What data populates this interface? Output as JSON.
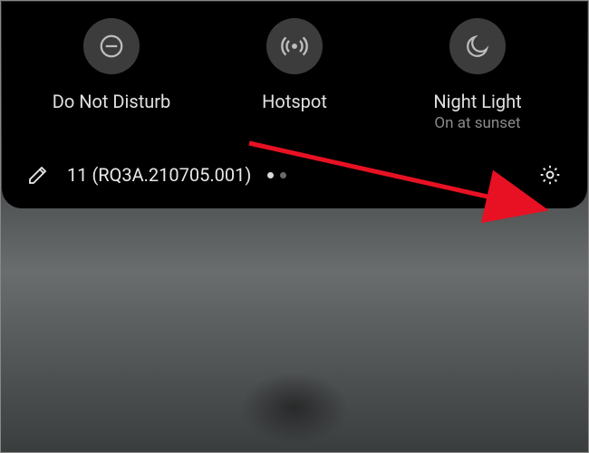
{
  "tiles": [
    {
      "label": "Do Not Disturb",
      "sublabel": "",
      "icon": "dnd"
    },
    {
      "label": "Hotspot",
      "sublabel": "",
      "icon": "hotspot"
    },
    {
      "label": "Night Light",
      "sublabel": "On at sunset",
      "icon": "nightlight"
    }
  ],
  "footer": {
    "version": "11 (RQ3A.210705.001)"
  },
  "pager": {
    "count": 2,
    "active": 0
  }
}
